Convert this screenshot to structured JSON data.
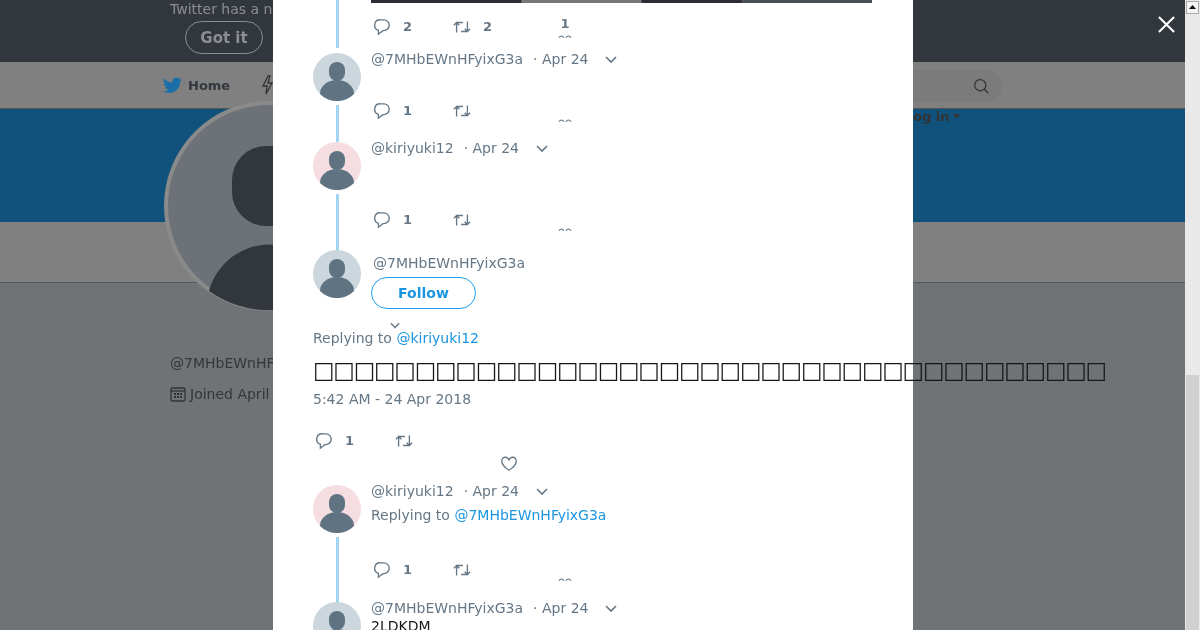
{
  "page": {
    "notice": "Twitter has a n",
    "got_it": "Got it",
    "home": "Home",
    "login": "og in",
    "profile_handle": "@7MHbEWnHF",
    "joined": "Joined April"
  },
  "thread": [
    {
      "kind": "actions",
      "replies": "2",
      "retweets": "2",
      "likes": "1"
    },
    {
      "kind": "tweet",
      "color": "#ccd6dd",
      "handle": "@7MHbEWnHFyixG3a",
      "date": "· Apr 24",
      "replies": "1"
    },
    {
      "kind": "tweet",
      "color": "#f6dde2",
      "handle": "@kiriyuki12",
      "date": "· Apr 24",
      "replies": "1"
    },
    {
      "kind": "focus",
      "color": "#ccd6dd",
      "handle": "@7MHbEWnHFyixG3a",
      "follow": "Follow",
      "replying_label": "Replying to",
      "replying_to": "@kiriyuki12",
      "text": "□□□□□□□□□□□□□□□□□□□□□□□□□□□□□□□□□□□□□□□",
      "timestamp": "5:42 AM - 24 Apr 2018",
      "replies": "1"
    },
    {
      "kind": "tweet",
      "color": "#f6dde2",
      "handle": "@kiriyuki12",
      "date": "· Apr 24",
      "replying_label": "Replying to",
      "replying_to": "@7MHbEWnHFyixG3a",
      "replies": "1"
    },
    {
      "kind": "tweet",
      "color": "#ccd6dd",
      "handle": "@7MHbEWnHFyixG3a",
      "date": "· Apr 24",
      "text": "2LDKDM"
    }
  ]
}
